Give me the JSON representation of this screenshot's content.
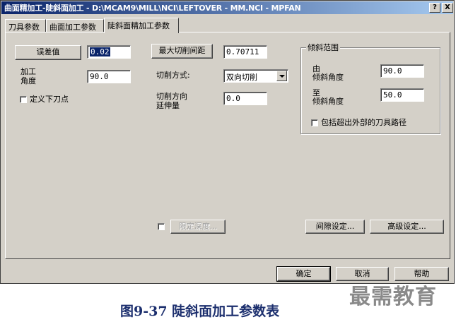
{
  "window": {
    "title": "曲面精加工-陡斜面加工 - D:\\MCAM9\\MILL\\NCI\\LEFTOVER - MM.NCI - MPFAN",
    "help_btn": "?",
    "close_btn": "X"
  },
  "tabs": [
    "刀具参数",
    "曲面加工参数",
    "陡斜面精加工参数"
  ],
  "form": {
    "tolerance_btn": "误差值",
    "tolerance_value": "0.02",
    "angle_label_1": "加工",
    "angle_label_2": "角度",
    "angle_value": "90.0",
    "entry_point_label": "定义下刀点",
    "max_stepover_btn": "最大切削间距",
    "max_stepover_value": "0.70711",
    "cut_method_label": "切削方式:",
    "cut_method_value": "双向切削",
    "extend_label_1": "切削方向",
    "extend_label_2": "延伸量",
    "extend_value": "0.0",
    "limit_depth_btn": "限定深度...",
    "gap_settings_btn": "间隙设定...",
    "advanced_settings_btn": "高级设定..."
  },
  "slope_group": {
    "title": "倾斜范围",
    "from_label_1": "由",
    "from_label_2": "倾斜角度",
    "from_value": "90.0",
    "to_label_1": "至",
    "to_label_2": "倾斜角度",
    "to_value": "50.0",
    "include_outside_label": "包括超出外部的刀具路径"
  },
  "footer": {
    "ok": "确定",
    "cancel": "取消",
    "help": "帮助"
  },
  "caption": "图9-37 陡斜面加工参数表",
  "watermark": "最需教育"
}
